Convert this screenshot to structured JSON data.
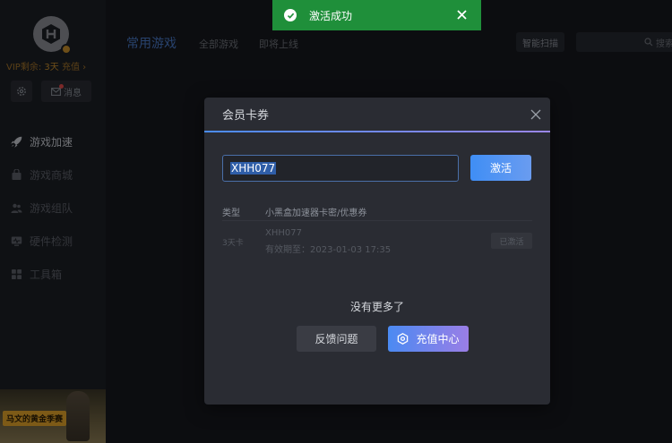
{
  "sidebar": {
    "vip_label": "VIP剩余:",
    "vip_days": "3天",
    "vip_recharge": "充值 ›",
    "messages_label": "消息",
    "nav": [
      {
        "label": "游戏加速",
        "icon": "rocket-icon"
      },
      {
        "label": "游戏商城",
        "icon": "bag-icon"
      },
      {
        "label": "游戏组队",
        "icon": "team-icon"
      },
      {
        "label": "硬件检测",
        "icon": "monitor-icon"
      },
      {
        "label": "工具箱",
        "icon": "grid-icon"
      }
    ],
    "promo_label": "马文的黄金季赛"
  },
  "header": {
    "title": "常用游戏",
    "tabs": [
      "全部游戏",
      "即将上线"
    ],
    "scan_label": "智能扫描",
    "search_placeholder": "搜索"
  },
  "toast": {
    "message": "激活成功",
    "color": "#1f8f3a"
  },
  "modal": {
    "title": "会员卡券",
    "code_value": "XHH077",
    "activate_label": "激活",
    "columns": {
      "type": "类型",
      "desc": "小黑盒加速器卡密/优惠券"
    },
    "row": {
      "type": "3天卡",
      "code": "XHH077",
      "expiry": "有效期至：2023-01-03 17:35",
      "status": "已激活"
    },
    "empty_text": "没有更多了",
    "feedback_label": "反馈问题",
    "recharge_label": "充值中心"
  }
}
